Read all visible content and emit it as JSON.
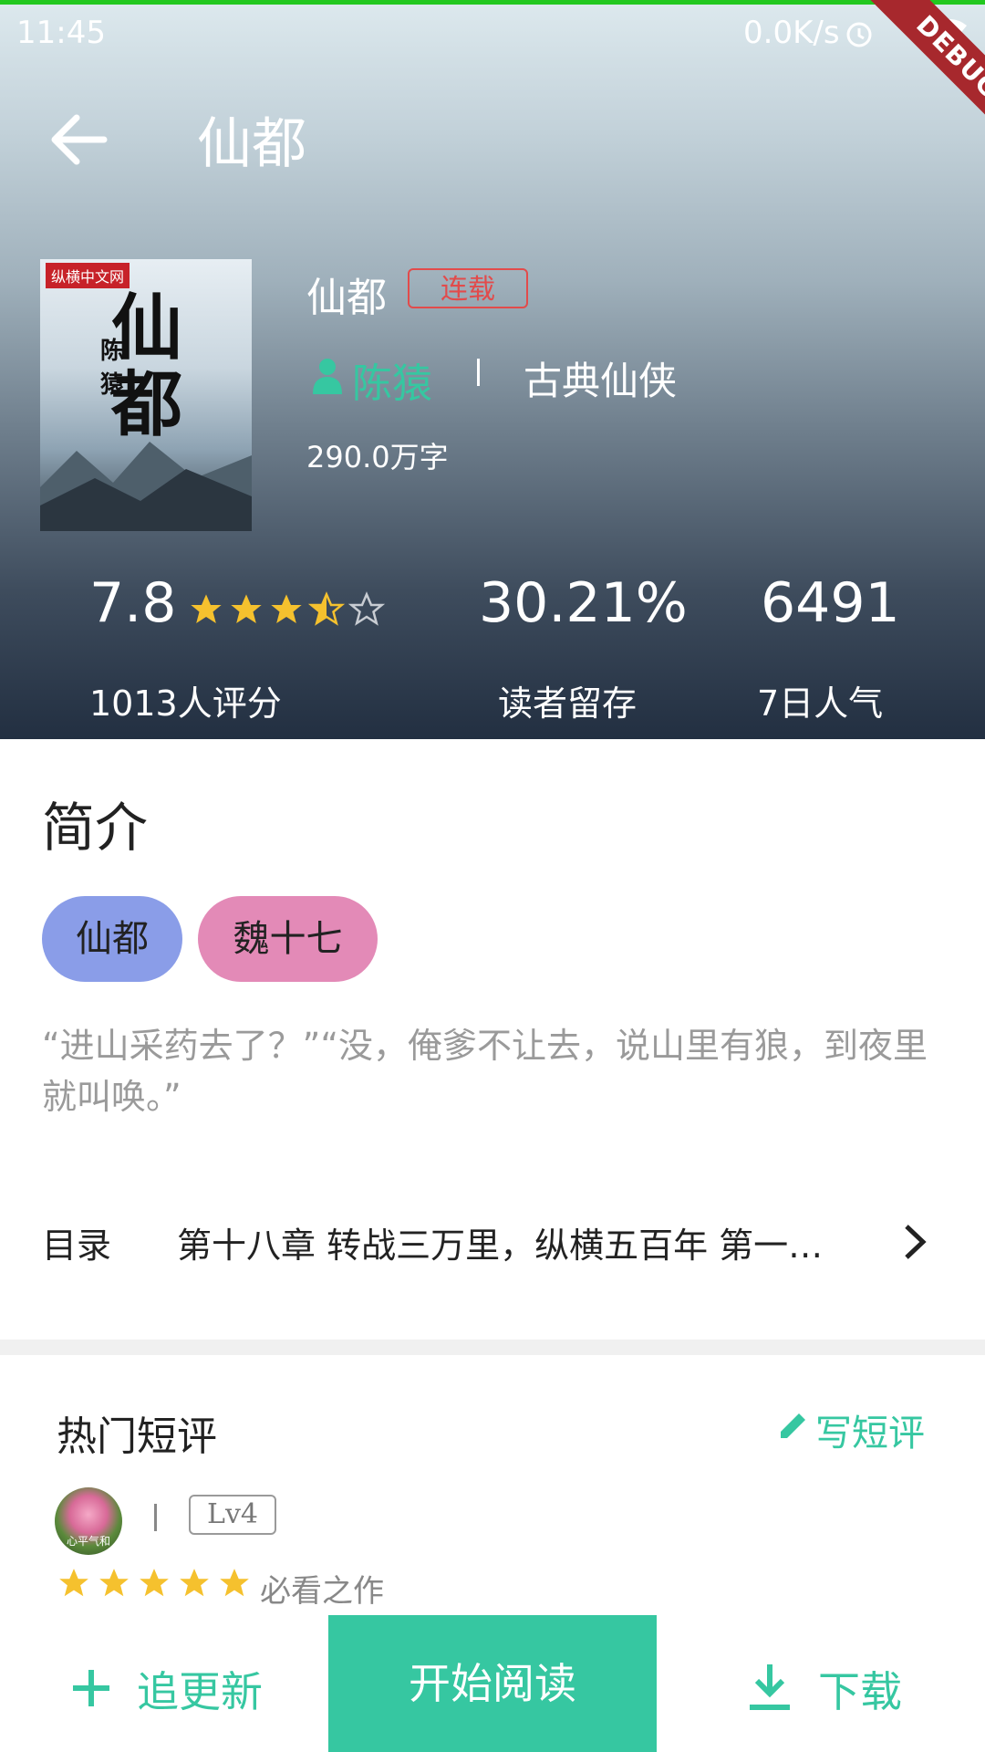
{
  "status_bar": {
    "time": "11:45",
    "net_speed": "0.0K/s",
    "debug": "DEBUG"
  },
  "app_bar": {
    "title": "仙都"
  },
  "book": {
    "cover": {
      "brand": "纵横中文网",
      "title": "仙都",
      "author": "陈猿"
    },
    "name": "仙都",
    "status_tag": "连载",
    "author": "陈猿",
    "genre": "古典仙侠",
    "word_count": "290.0万字"
  },
  "stats": {
    "score": "7.8",
    "stars": 3.5,
    "score_label": "1013人评分",
    "retention": "30.21%",
    "retention_label": "读者留存",
    "popularity": "6491",
    "popularity_label": "7日人气"
  },
  "intro": {
    "title": "简介",
    "tags": [
      "仙都",
      "魏十七"
    ],
    "text": "“进山采药去了？”“没，俺爹不让去，说山里有狼，到夜里就叫唤。”"
  },
  "toc": {
    "label": "目录",
    "latest_chapter": "第十八章 转战三万里，纵横五百年 第一…"
  },
  "reviews": {
    "title": "热门短评",
    "write_label": "写短评",
    "items": [
      {
        "avatar_text": "心平气和",
        "level": "Lv4",
        "stars": 5,
        "text": "必看之作"
      }
    ]
  },
  "bottom_bar": {
    "follow_label": "追更新",
    "read_label": "开始阅读",
    "download_label": "下载"
  },
  "colors": {
    "accent": "#36c7a1",
    "tag_red": "#e24b4b",
    "star": "#f5c12e"
  }
}
